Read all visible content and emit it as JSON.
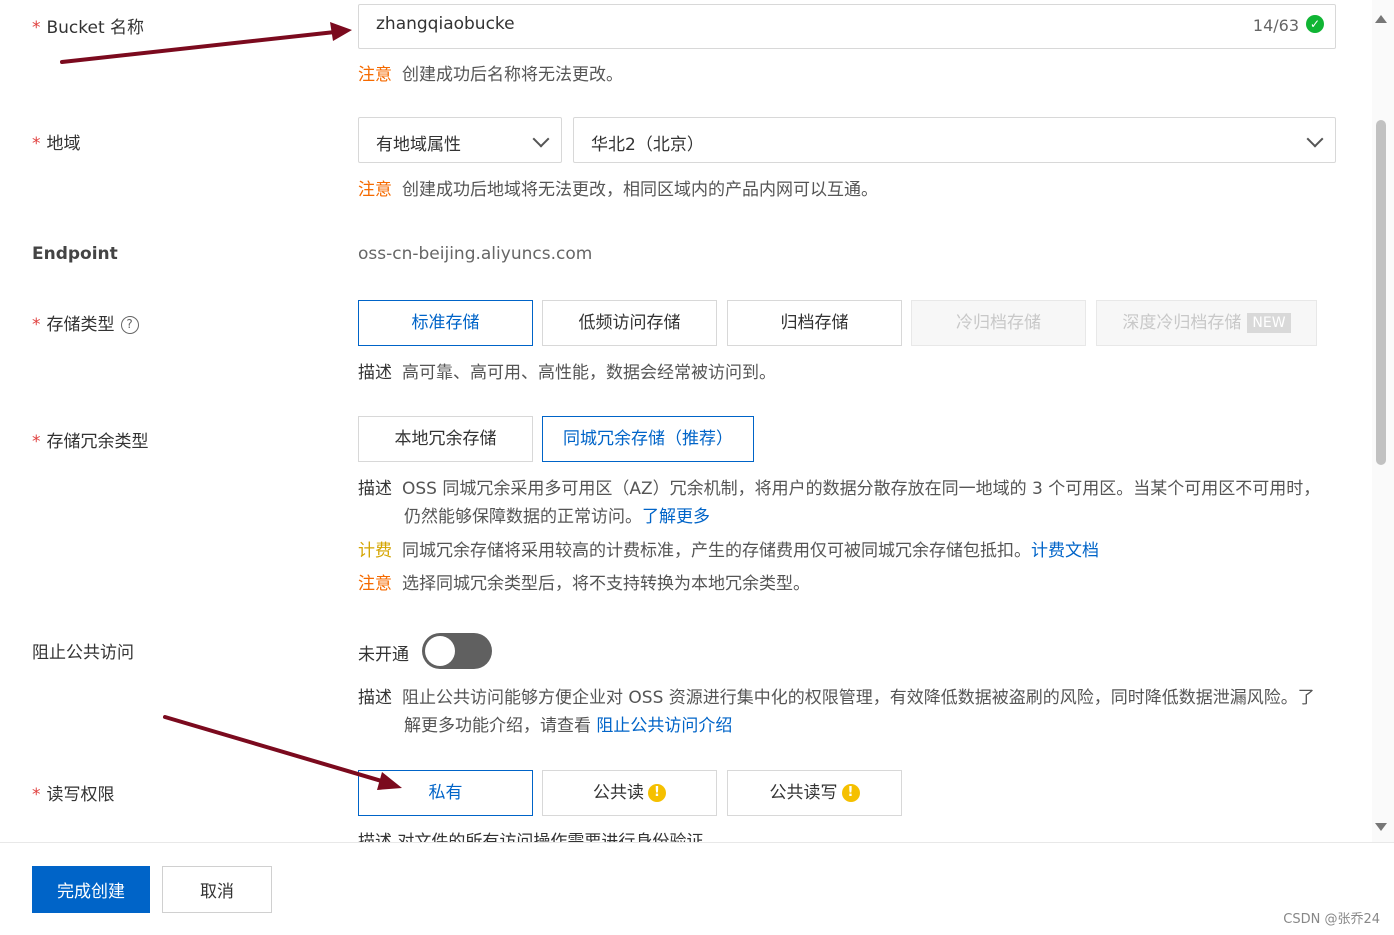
{
  "bucket_name": {
    "label": "Bucket 名称",
    "value": "zhangqiaobucke",
    "counter": "14/63",
    "note_tag": "注意",
    "note_text": "创建成功后名称将无法更改。"
  },
  "region": {
    "label": "地域",
    "type_select": "有地域属性",
    "region_select": "华北2（北京）",
    "note_tag": "注意",
    "note_text": "创建成功后地域将无法更改，相同区域内的产品内网可以互通。"
  },
  "endpoint": {
    "label": "Endpoint",
    "value": "oss-cn-beijing.aliyuncs.com"
  },
  "storage_class": {
    "label": "存储类型",
    "options": [
      "标准存储",
      "低频访问存储",
      "归档存储",
      "冷归档存储",
      "深度冷归档存储"
    ],
    "new_badge": "NEW",
    "desc_tag": "描述",
    "desc_text": "高可靠、高可用、高性能，数据会经常被访问到。"
  },
  "redundancy": {
    "label": "存储冗余类型",
    "options": [
      "本地冗余存储",
      "同城冗余存储（推荐）"
    ],
    "desc_tag": "描述",
    "desc_line1": "OSS 同城冗余采用多可用区（AZ）冗余机制，将用户的数据分散存放在同一地域的 3 个可用区。当某个可用区不可用时，",
    "desc_line2": "仍然能够保障数据的正常访问。",
    "desc_link": "了解更多",
    "fee_tag": "计费",
    "fee_text": "同城冗余存储将采用较高的计费标准，产生的存储费用仅可被同城冗余存储包抵扣。",
    "fee_link": "计费文档",
    "note_tag": "注意",
    "note_text": "选择同城冗余类型后，将不支持转换为本地冗余类型。"
  },
  "block_public": {
    "label": "阻止公共访问",
    "status": "未开通",
    "desc_tag": "描述",
    "desc_line1": "阻止公共访问能够方便企业对 OSS 资源进行集中化的权限管理，有效降低数据被盗刷的风险，同时降低数据泄漏风险。了",
    "desc_line2": "解更多功能介绍，请查看",
    "desc_link": "阻止公共访问介绍"
  },
  "acl": {
    "label": "读写权限",
    "options": [
      "私有",
      "公共读",
      "公共读写"
    ],
    "desc_partial": "描述  对文件的所有访问操作需要进行身份验证。"
  },
  "footer": {
    "create": "完成创建",
    "cancel": "取消"
  },
  "watermark": "CSDN @张乔24",
  "colors": {
    "primary": "#0064c8",
    "note": "#f56a00",
    "fee": "#d4a400",
    "required": "#e0413f",
    "annotation_arrow": "#7b0a1e"
  }
}
